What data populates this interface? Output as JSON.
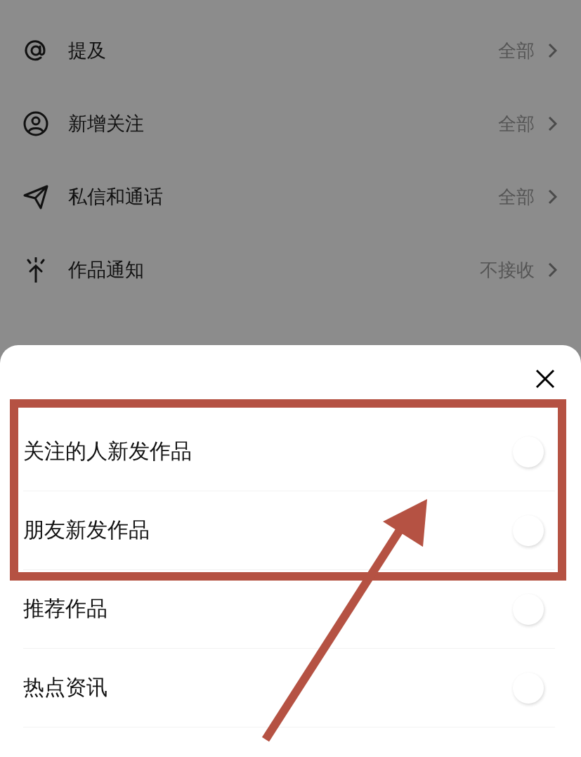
{
  "settings": [
    {
      "label": "提及",
      "value": "全部"
    },
    {
      "label": "新增关注",
      "value": "全部"
    },
    {
      "label": "私信和通话",
      "value": "全部"
    },
    {
      "label": "作品通知",
      "value": "不接收"
    }
  ],
  "sheet": {
    "options": [
      {
        "label": "关注的人新发作品",
        "on": false
      },
      {
        "label": "朋友新发作品",
        "on": false
      },
      {
        "label": "推荐作品",
        "on": false
      },
      {
        "label": "热点资讯",
        "on": false
      }
    ]
  }
}
